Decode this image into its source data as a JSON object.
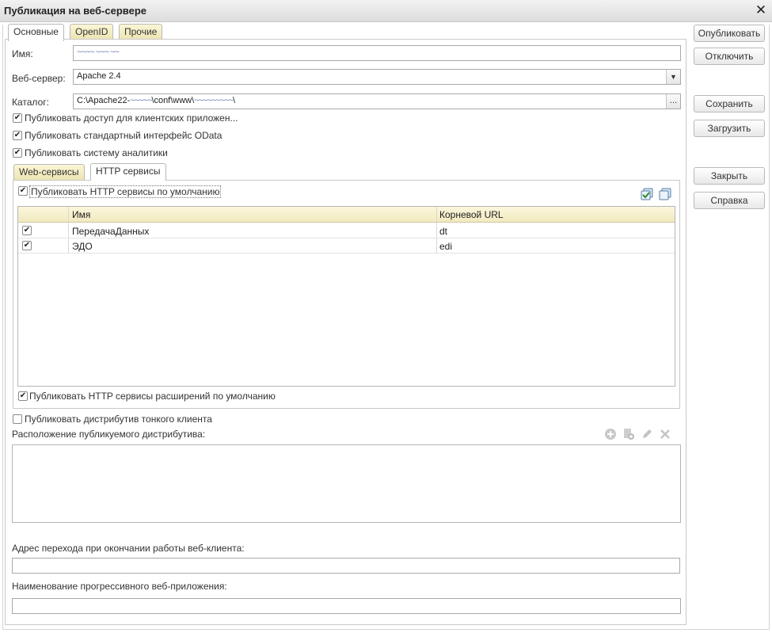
{
  "window": {
    "title": "Публикация на веб-сервере"
  },
  "tabs": [
    "Основные",
    "OpenID",
    "Прочие"
  ],
  "fields": {
    "name_label": "Имя:",
    "name_value": "~~~~ ~~~ ~~",
    "server_label": "Веб-сервер:",
    "server_value": "Apache 2.4",
    "catalog_label": "Каталог:",
    "catalog_prefix": "C:\\Apache22-",
    "catalog_mid": "\\conf\\www\\",
    "catalog_suffix": "\\",
    "catalog_browse": "...",
    "dropdown_arrow": "▼"
  },
  "checkboxes": {
    "client_apps": "Публиковать доступ для клиентских приложен...",
    "odata": "Публиковать стандартный интерфейс OData",
    "analytics": "Публиковать систему аналитики"
  },
  "subtabs": [
    "Web-сервисы",
    "HTTP сервисы"
  ],
  "http": {
    "publish_default": "Публиковать HTTP сервисы по умолчанию",
    "columns": {
      "name": "Имя",
      "root_url": "Корневой URL"
    },
    "rows": [
      {
        "checked": true,
        "name": "ПередачаДанных",
        "url": "dt"
      },
      {
        "checked": true,
        "name": "ЭДО",
        "url": "edi"
      }
    ],
    "publish_extensions": "Публиковать HTTP сервисы расширений по умолчанию"
  },
  "distributive": {
    "publish_thin_client": "Публиковать дистрибутив тонкого клиента",
    "location_label": "Расположение публикуемого дистрибутива:"
  },
  "exit_url_label": "Адрес перехода при окончании работы веб-клиента:",
  "pwa_label": "Наименование прогрессивного веб-приложения:",
  "buttons": {
    "publish": "Опубликовать",
    "disable": "Отключить",
    "save": "Сохранить",
    "load": "Загрузить",
    "close": "Закрыть",
    "help": "Справка"
  },
  "icons": {
    "close": "close-icon",
    "check_all": "check-all-icon",
    "uncheck_all": "uncheck-all-icon",
    "add": "add-icon",
    "copy": "copy-icon",
    "edit": "edit-icon",
    "delete": "delete-icon"
  },
  "colors": {
    "tab_bg": "#ece3b0",
    "grid_header": "#f1e9bf",
    "title_bg": "#dcdcdc"
  }
}
